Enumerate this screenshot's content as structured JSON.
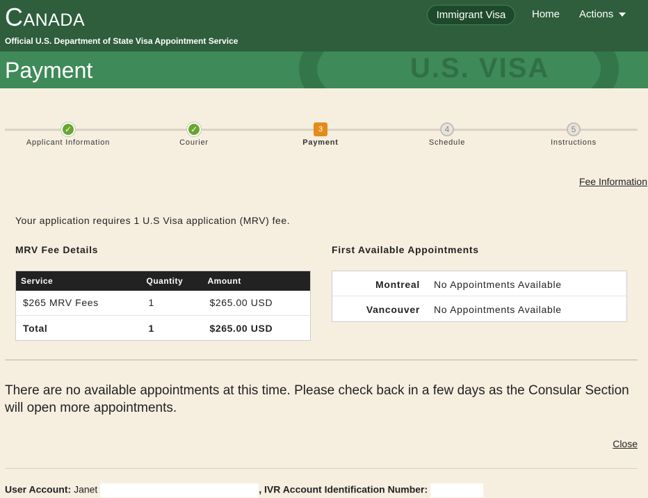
{
  "header": {
    "country": "Canada",
    "subtitle": "Official U.S. Department of State Visa Appointment Service",
    "nav": {
      "visa_type": "Immigrant Visa",
      "home": "Home",
      "actions": "Actions"
    }
  },
  "page": {
    "title": "Payment",
    "watermark": "U.S. VISA"
  },
  "steps": [
    {
      "num": "1",
      "label": "Applicant Information",
      "state": "done"
    },
    {
      "num": "2",
      "label": "Courier",
      "state": "done"
    },
    {
      "num": "3",
      "label": "Payment",
      "state": "current"
    },
    {
      "num": "4",
      "label": "Schedule",
      "state": "todo"
    },
    {
      "num": "5",
      "label": "Instructions",
      "state": "todo"
    }
  ],
  "fee_information_link": "Fee Information",
  "requirement_text": "Your application requires 1 U.S Visa application (MRV) fee.",
  "mrv": {
    "heading": "MRV Fee Details",
    "columns": [
      "Service",
      "Quantity",
      "Amount"
    ],
    "rows": [
      {
        "service": "$265 MRV Fees",
        "quantity": "1",
        "amount": "$265.00 USD"
      }
    ],
    "total": {
      "label": "Total",
      "quantity": "1",
      "amount": "$265.00 USD"
    }
  },
  "appointments": {
    "heading": "First Available Appointments",
    "rows": [
      {
        "city": "Montreal",
        "status": "No Appointments Available"
      },
      {
        "city": "Vancouver",
        "status": "No Appointments Available"
      }
    ]
  },
  "notice": "There are no available appointments at this time. Please check back in a few days as the Consular Section will open more appointments.",
  "close_link": "Close",
  "footer": {
    "user_account_label": "User Account:",
    "user_name": "Janet",
    "ivr_label": ", IVR Account Identification Number:"
  }
}
